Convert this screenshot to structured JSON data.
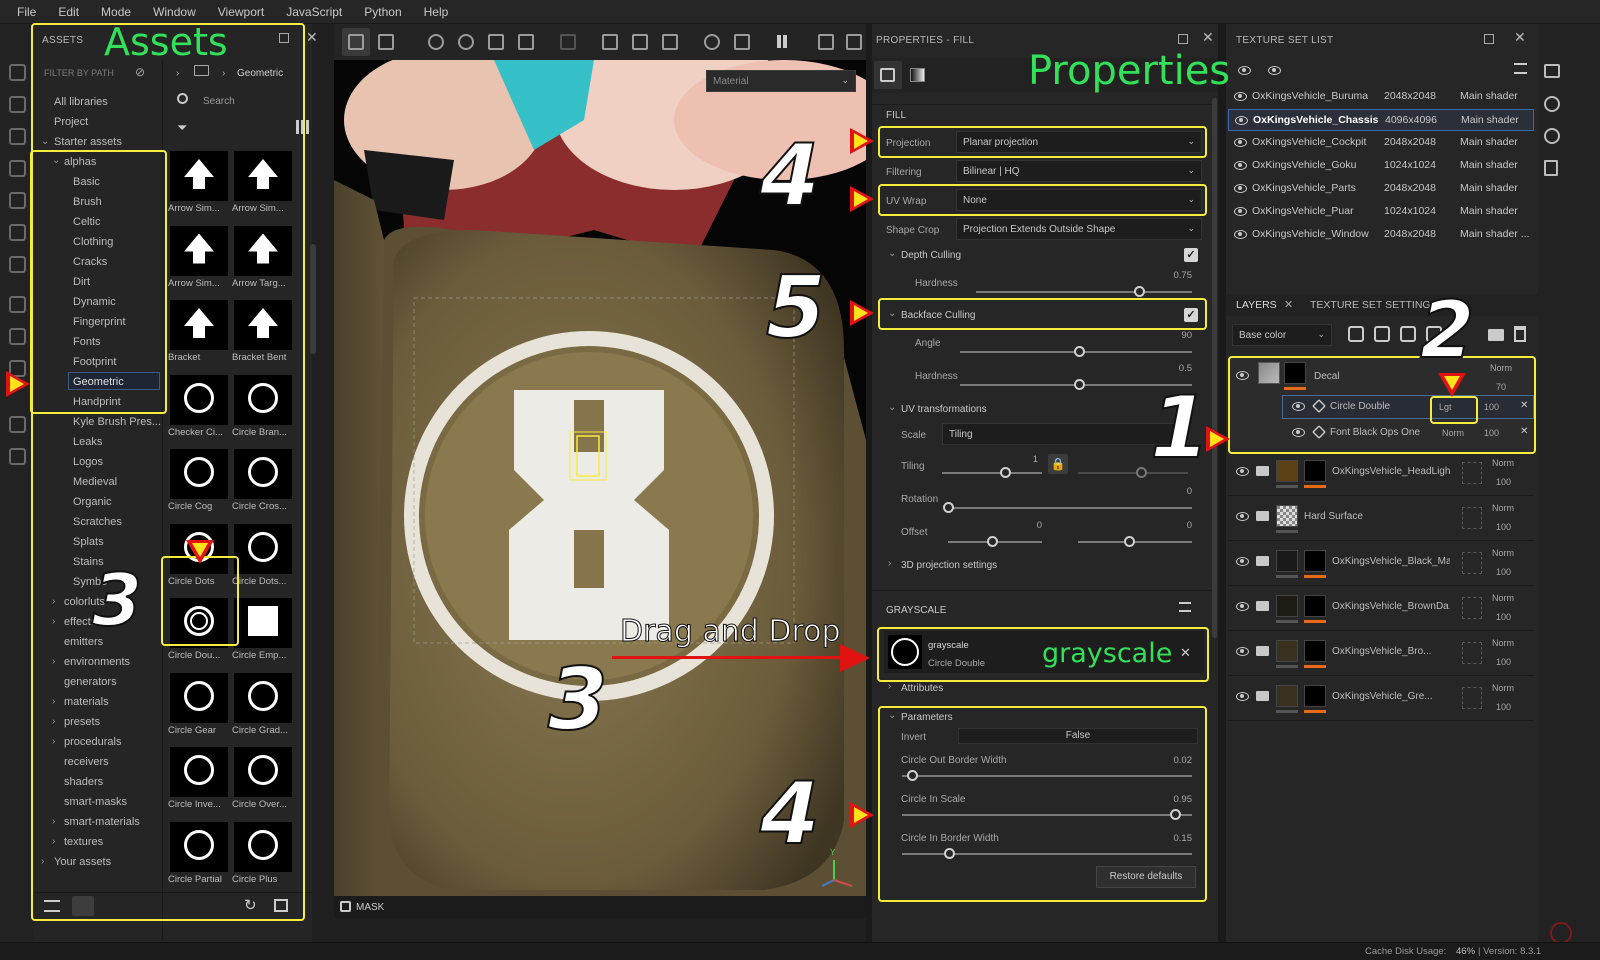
{
  "menubar": {
    "items": [
      "File",
      "Edit",
      "Mode",
      "Window",
      "Viewport",
      "JavaScript",
      "Python",
      "Help"
    ]
  },
  "assets": {
    "title": "ASSETS",
    "annotation": "Assets",
    "filter_label": "FILTER BY PATH",
    "breadcrumb": "Geometric",
    "search_placeholder": "Search",
    "tree": [
      "All libraries",
      "Project",
      "Starter assets",
      "alphas",
      "Basic",
      "Brush",
      "Celtic",
      "Clothing",
      "Cracks",
      "Dirt",
      "Dynamic",
      "Fingerprint",
      "Fonts",
      "Footprint",
      "Geometric",
      "Handprint",
      "Kyle Brush Pres...",
      "Leaks",
      "Logos",
      "Medieval",
      "Organic",
      "Scratches",
      "Splats",
      "Stains",
      "Symbo",
      "colorluts",
      "effects",
      "emitters",
      "environments",
      "generators",
      "materials",
      "presets",
      "procedurals",
      "receivers",
      "shaders",
      "smart-masks",
      "smart-materials",
      "textures",
      "Your assets"
    ],
    "thumbs": [
      "Arrow Sim...",
      "Arrow Sim...",
      "Arrow Sim...",
      "Arrow Targ...",
      "Bracket",
      "Bracket Bent",
      "Checker Ci...",
      "Circle Bran...",
      "Circle Cog",
      "Circle Cros...",
      "Circle Dots",
      "Circle Dots...",
      "Circle Dou...",
      "Circle Emp...",
      "Circle Gear",
      "Circle Grad...",
      "Circle Inve...",
      "Circle Over...",
      "Circle Partial",
      "Circle Plus"
    ]
  },
  "viewport": {
    "material_dropdown": "Material",
    "mask_label": "MASK",
    "drag_label": "Drag and Drop"
  },
  "properties": {
    "title": "PROPERTIES - FILL",
    "annotation": "Properties",
    "fill_header": "FILL",
    "projection_label": "Projection",
    "projection_value": "Planar projection",
    "filtering_label": "Filtering",
    "filtering_value": "Bilinear | HQ",
    "uvwrap_label": "UV Wrap",
    "uvwrap_value": "None",
    "shapecrop_label": "Shape Crop",
    "shapecrop_value": "Projection Extends Outside Shape",
    "depth_culling": "Depth Culling",
    "hardness_label": "Hardness",
    "depth_hardness": "0.75",
    "backface_culling": "Backface Culling",
    "angle_label": "Angle",
    "angle_value": "90",
    "bf_hardness": "0.5",
    "uv_transform": "UV transformations",
    "scale_label": "Scale",
    "scale_value": "Tiling",
    "tiling_label": "Tiling",
    "tiling_value": "1",
    "rotation_label": "Rotation",
    "rotation_value": "0",
    "offset_label": "Offset",
    "offset_x": "0",
    "offset_y": "0",
    "proj3d": "3D projection settings",
    "grayscale_header": "GRAYSCALE",
    "gs_name": "grayscale",
    "gs_sub": "Circle Double",
    "gs_annotation": "grayscale",
    "attributes": "Attributes",
    "parameters": "Parameters",
    "invert_label": "Invert",
    "invert_value": "False",
    "p1_label": "Circle Out Border Width",
    "p1_value": "0.02",
    "p2_label": "Circle In Scale",
    "p2_value": "0.95",
    "p3_label": "Circle In Border Width",
    "p3_value": "0.15",
    "restore": "Restore defaults"
  },
  "texture_set_list": {
    "title": "TEXTURE SET LIST",
    "rows": [
      {
        "name": "OxKingsVehicle_Buruma",
        "size": "2048x2048",
        "shader": "Main shader"
      },
      {
        "name": "OxKingsVehicle_Chassis",
        "size": "4096x4096",
        "shader": "Main shader"
      },
      {
        "name": "OxKingsVehicle_Cockpit",
        "size": "2048x2048",
        "shader": "Main shader"
      },
      {
        "name": "OxKingsVehicle_Goku",
        "size": "1024x1024",
        "shader": "Main shader"
      },
      {
        "name": "OxKingsVehicle_Parts",
        "size": "2048x2048",
        "shader": "Main shader"
      },
      {
        "name": "OxKingsVehicle_Puar",
        "size": "1024x1024",
        "shader": "Main shader"
      },
      {
        "name": "OxKingsVehicle_Window",
        "size": "2048x2048",
        "shader": "Main shader ..."
      }
    ]
  },
  "layers": {
    "tab_layers": "LAYERS",
    "tab_settings": "TEXTURE SET SETTINGS",
    "channel": "Base color",
    "decal": {
      "name": "Decal",
      "blend": "Norm",
      "opacity": "70"
    },
    "sub1": {
      "name": "Circle Double",
      "blend": "Lgt",
      "opacity": "100"
    },
    "sub2": {
      "name": "Font Black Ops One",
      "blend": "Norm",
      "opacity": "100"
    },
    "rows": [
      {
        "name": "OxKingsVehicle_HeadLigh...",
        "blend": "Norm",
        "opacity": "100"
      },
      {
        "name": "Hard Surface",
        "blend": "Norm",
        "opacity": "100"
      },
      {
        "name": "OxKingsVehicle_Black_Ma...",
        "blend": "Norm",
        "opacity": "100"
      },
      {
        "name": "OxKingsVehicle_BrownDa...",
        "blend": "Norm",
        "opacity": "100"
      },
      {
        "name": "OxKingsVehicle_Bro...",
        "blend": "Norm",
        "opacity": "100"
      },
      {
        "name": "OxKingsVehicle_Gre...",
        "blend": "Norm",
        "opacity": "100"
      }
    ]
  },
  "status": {
    "cache": "Cache Disk Usage:",
    "cache_value": "46%",
    "version": "| Version: 8.3.1"
  },
  "annotations": {
    "n1": "1",
    "n2": "2",
    "n3a": "3",
    "n3b": "3",
    "n4a": "4",
    "n4b": "4",
    "n5": "5"
  },
  "colors": {
    "highlight": "#f6ec3c",
    "annotation_green": "#33e05a",
    "arrow_red": "#e01212",
    "accent_orange": "#e86a17"
  }
}
